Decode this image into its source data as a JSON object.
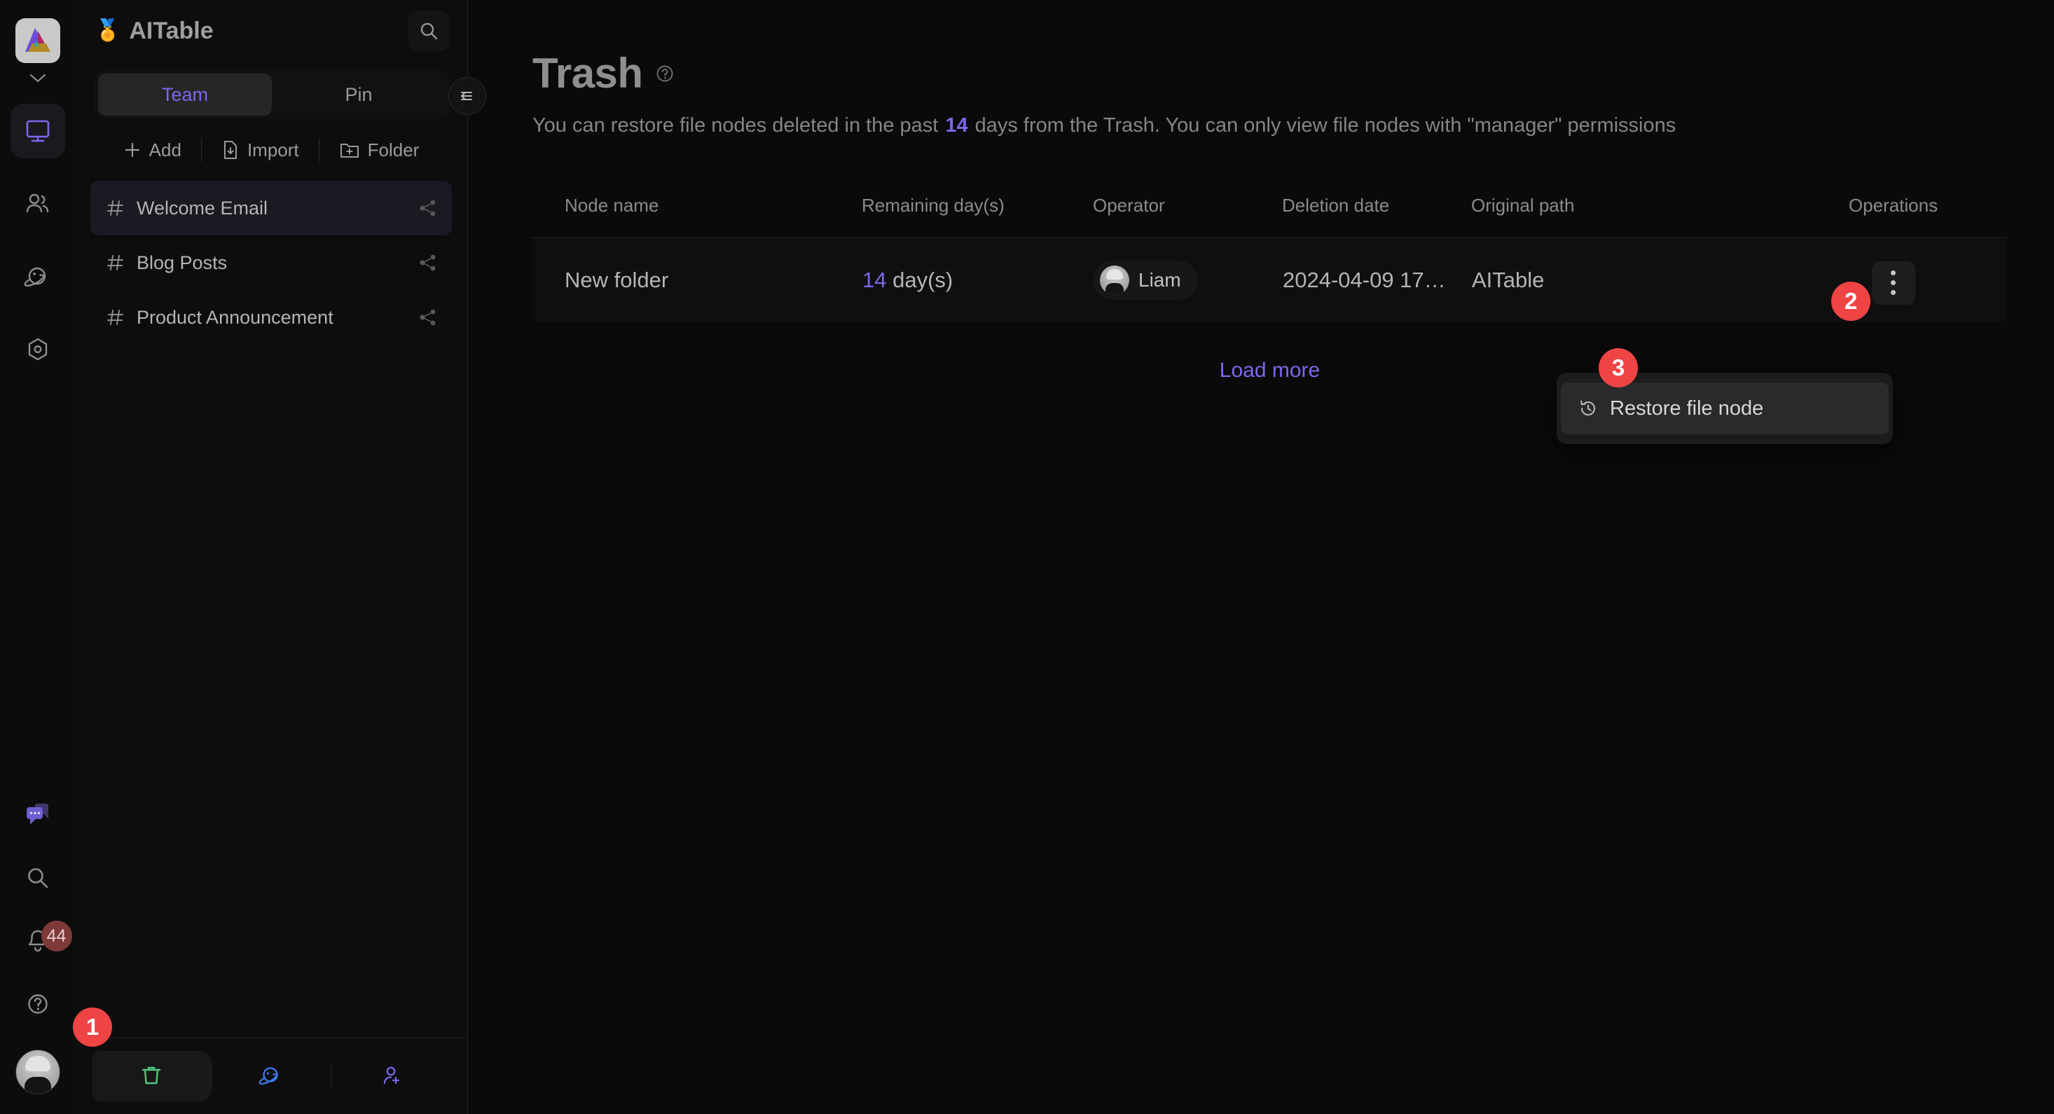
{
  "app": {
    "space_name": "AITable",
    "space_emoji": "🏅"
  },
  "rail": {
    "items": [
      {
        "name": "workbench",
        "icon": "monitor-icon",
        "active": true
      },
      {
        "name": "members",
        "icon": "users-icon",
        "active": false
      },
      {
        "name": "space",
        "icon": "planet-icon",
        "active": false
      },
      {
        "name": "templates",
        "icon": "hexagon-icon",
        "active": false
      }
    ],
    "bottom_items": [
      {
        "name": "chat",
        "icon": "chat-bubbles-icon"
      },
      {
        "name": "search",
        "icon": "search-icon"
      },
      {
        "name": "notifications",
        "icon": "bell-icon",
        "badge": "44"
      },
      {
        "name": "help",
        "icon": "question-circle-icon"
      }
    ]
  },
  "panel": {
    "search_icon": "search-icon",
    "tabs": [
      {
        "label": "Team",
        "active": true
      },
      {
        "label": "Pin",
        "active": false
      }
    ],
    "actions": [
      {
        "label": "Add",
        "icon": "plus-icon"
      },
      {
        "label": "Import",
        "icon": "file-import-icon"
      },
      {
        "label": "Folder",
        "icon": "folder-plus-icon"
      }
    ],
    "nodes": [
      {
        "label": "Welcome Email",
        "icon": "hash-icon",
        "share_icon": "share-icon",
        "active": true
      },
      {
        "label": "Blog Posts",
        "icon": "hash-icon",
        "share_icon": "share-icon",
        "active": false
      },
      {
        "label": "Product Announcement",
        "icon": "hash-icon",
        "share_icon": "share-icon",
        "active": false
      }
    ],
    "bottom_tabs": [
      {
        "name": "trash",
        "icon": "trash-icon",
        "color": "#4ec97e",
        "active": true
      },
      {
        "name": "space-manage",
        "icon": "planet-icon",
        "color": "#3f7bea",
        "active": false
      },
      {
        "name": "invite",
        "icon": "user-plus-icon",
        "color": "#7b68ee",
        "active": false
      }
    ],
    "collapse_icon": "collapse-panel-icon"
  },
  "main": {
    "title": "Trash",
    "title_help_icon": "question-circle-icon",
    "description_prefix": "You can restore file nodes deleted in the past",
    "description_days": "14",
    "description_suffix": "days from the Trash. You can only view file nodes with \"manager\" permissions",
    "columns": [
      "Node name",
      "Remaining day(s)",
      "Operator",
      "Deletion date",
      "Original path",
      "Operations"
    ],
    "rows": [
      {
        "node_name": "New folder",
        "remaining_days_number": "14",
        "remaining_days_unit": "day(s)",
        "operator": "Liam",
        "deletion_date": "2024-04-09 17…",
        "original_path": "AITable",
        "operations_icon": "kebab-menu-icon"
      }
    ],
    "load_more": "Load more"
  },
  "menu": {
    "items": [
      {
        "label": "Restore file node",
        "icon": "restore-icon",
        "highlighted": true
      }
    ]
  },
  "steps": [
    {
      "label": "1"
    },
    {
      "label": "2"
    },
    {
      "label": "3"
    }
  ],
  "colors": {
    "accent": "#7b68ee",
    "step_badge": "#ef4444",
    "trash_green": "#4ec97e",
    "planet_blue": "#3f7bea",
    "background": "#0a0a0a"
  }
}
